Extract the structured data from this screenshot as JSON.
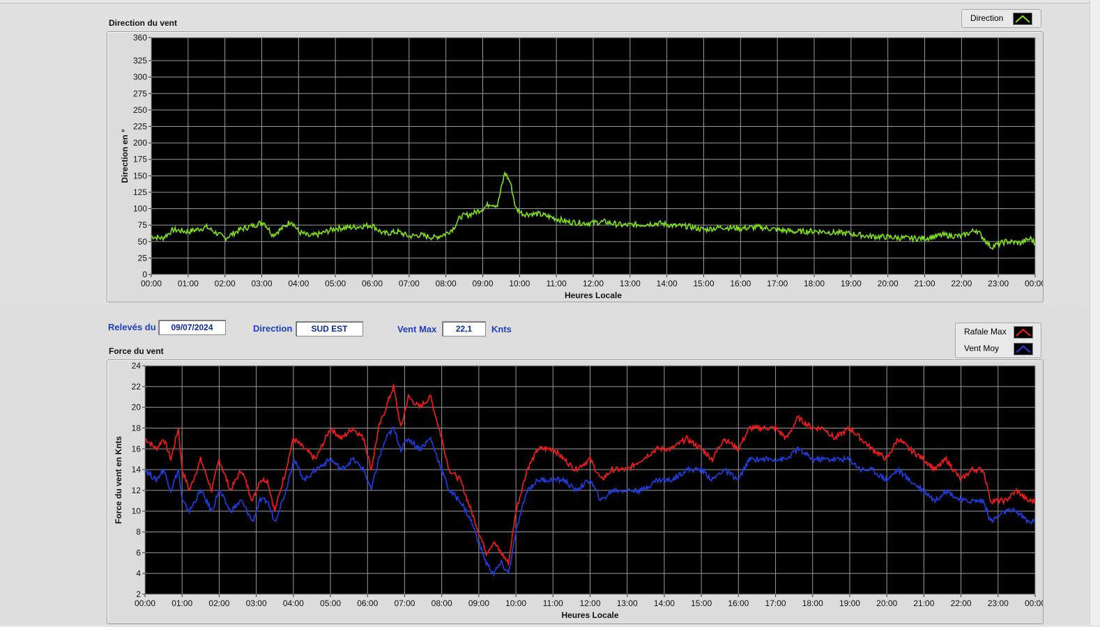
{
  "controls": {
    "releves_label": "Relevés du",
    "releves_value": "09/07/2024",
    "direction_label": "Direction",
    "direction_value": "SUD EST",
    "ventmax_label": "Vent Max",
    "ventmax_value": "22,1",
    "ventmax_unit": "Knts"
  },
  "legends": {
    "direction": "Direction",
    "rafale": "Rafale Max",
    "ventmoy": "Vent Moy"
  },
  "colors": {
    "plot_bg": "#000000",
    "grid": "#9a9a9a",
    "direction": "#7fe31a",
    "rafale": "#ff1a1a",
    "ventmoy": "#1f3fe8",
    "label_blue": "#1f3fbf"
  },
  "chart_data": [
    {
      "type": "line",
      "title": "Direction du vent",
      "xlabel": "Heures Locale",
      "ylabel": "Direction en °",
      "ylim": [
        0,
        360
      ],
      "yticks": [
        0,
        25,
        50,
        75,
        100,
        125,
        150,
        175,
        200,
        225,
        250,
        275,
        300,
        325,
        360
      ],
      "xticks": [
        "00:00",
        "01:00",
        "02:00",
        "03:00",
        "04:00",
        "05:00",
        "06:00",
        "07:00",
        "08:00",
        "09:00",
        "10:00",
        "11:00",
        "12:00",
        "13:00",
        "14:00",
        "15:00",
        "16:00",
        "17:00",
        "18:00",
        "19:00",
        "20:00",
        "21:00",
        "22:00",
        "23:00",
        "00:00"
      ],
      "xlim": [
        0,
        24
      ],
      "grid": true,
      "legend": "top-right",
      "series": [
        {
          "name": "Direction",
          "x": [
            0,
            0.3,
            0.6,
            1,
            1.5,
            1.8,
            2,
            2.4,
            2.8,
            3.05,
            3.3,
            3.6,
            3.8,
            4,
            4.3,
            4.6,
            5,
            5.5,
            6,
            6.3,
            6.7,
            7,
            7.3,
            7.7,
            8,
            8.2,
            8.4,
            8.7,
            9,
            9.2,
            9.4,
            9.6,
            9.75,
            9.9,
            10.1,
            10.5,
            10.8,
            11.3,
            11.8,
            12.3,
            12.8,
            13.3,
            13.8,
            14.2,
            14.6,
            15,
            15.5,
            16,
            16.5,
            17,
            17.5,
            18,
            18.5,
            19,
            19.5,
            20,
            20.5,
            21,
            21.5,
            22,
            22.4,
            22.6,
            22.8,
            23.2,
            23.6,
            23.9,
            24
          ],
          "y": [
            58,
            55,
            68,
            65,
            72,
            62,
            55,
            68,
            75,
            80,
            60,
            72,
            82,
            65,
            58,
            62,
            70,
            72,
            75,
            62,
            65,
            58,
            60,
            56,
            62,
            70,
            88,
            92,
            100,
            108,
            105,
            155,
            140,
            100,
            92,
            92,
            88,
            80,
            78,
            80,
            75,
            76,
            78,
            74,
            73,
            68,
            72,
            70,
            72,
            68,
            65,
            66,
            64,
            62,
            58,
            57,
            55,
            55,
            60,
            58,
            68,
            55,
            42,
            50,
            48,
            55,
            45
          ]
        }
      ]
    },
    {
      "type": "line",
      "title": "Force du vent",
      "xlabel": "Heures Locale",
      "ylabel": "Force du vent en Knts",
      "ylim": [
        2,
        24
      ],
      "yticks": [
        2,
        4,
        6,
        8,
        10,
        12,
        14,
        16,
        18,
        20,
        22,
        24
      ],
      "xticks": [
        "00:00",
        "01:00",
        "02:00",
        "03:00",
        "04:00",
        "05:00",
        "06:00",
        "07:00",
        "08:00",
        "09:00",
        "10:00",
        "11:00",
        "12:00",
        "13:00",
        "14:00",
        "15:00",
        "16:00",
        "17:00",
        "18:00",
        "19:00",
        "20:00",
        "21:00",
        "22:00",
        "23:00",
        "00:00"
      ],
      "xlim": [
        0,
        24
      ],
      "grid": true,
      "legend": "top-right",
      "series": [
        {
          "name": "Rafale Max",
          "x": [
            0,
            0.3,
            0.5,
            0.7,
            0.9,
            1,
            1.2,
            1.5,
            1.8,
            2,
            2.3,
            2.6,
            2.9,
            3.1,
            3.3,
            3.5,
            3.8,
            4,
            4.3,
            4.6,
            5,
            5.3,
            5.6,
            5.9,
            6.1,
            6.3,
            6.5,
            6.7,
            6.9,
            7.1,
            7.4,
            7.7,
            8,
            8.2,
            8.5,
            8.8,
            9,
            9.2,
            9.4,
            9.6,
            9.8,
            10,
            10.3,
            10.6,
            11,
            11.3,
            11.6,
            12,
            12.3,
            12.6,
            13,
            13.4,
            13.8,
            14.2,
            14.6,
            15,
            15.3,
            15.6,
            16,
            16.3,
            16.6,
            17,
            17.3,
            17.6,
            18,
            18.3,
            18.6,
            19,
            19.3,
            19.6,
            20,
            20.3,
            20.6,
            21,
            21.3,
            21.6,
            22,
            22.3,
            22.6,
            22.8,
            23.2,
            23.5,
            23.8,
            24
          ],
          "y": [
            17,
            16,
            17,
            15,
            18,
            14,
            12,
            15,
            12,
            15,
            12,
            14,
            11,
            13,
            13,
            10,
            14,
            17,
            16,
            15,
            18,
            17,
            18,
            17,
            14,
            18,
            20,
            22,
            18,
            21,
            20,
            21,
            17,
            14,
            13,
            10,
            8,
            6,
            7,
            6,
            5,
            10,
            14,
            16,
            16,
            15,
            14,
            15,
            13,
            14,
            14,
            15,
            16,
            16,
            17,
            16,
            15,
            17,
            16,
            18,
            18,
            18,
            17,
            19,
            18,
            18,
            17,
            18,
            17,
            16,
            15,
            17,
            16,
            15,
            14,
            15,
            13,
            14,
            14,
            11,
            11,
            12,
            11,
            11
          ]
        },
        {
          "name": "Vent Moy",
          "x": [
            0,
            0.3,
            0.5,
            0.7,
            0.9,
            1,
            1.2,
            1.5,
            1.8,
            2,
            2.3,
            2.6,
            2.9,
            3.1,
            3.3,
            3.5,
            3.8,
            4,
            4.3,
            4.6,
            5,
            5.3,
            5.6,
            5.9,
            6.1,
            6.3,
            6.5,
            6.7,
            6.9,
            7.1,
            7.4,
            7.7,
            8,
            8.2,
            8.5,
            8.8,
            9,
            9.2,
            9.4,
            9.6,
            9.8,
            10,
            10.3,
            10.6,
            11,
            11.3,
            11.6,
            12,
            12.3,
            12.6,
            13,
            13.4,
            13.8,
            14.2,
            14.6,
            15,
            15.3,
            15.6,
            16,
            16.3,
            16.6,
            17,
            17.3,
            17.6,
            18,
            18.3,
            18.6,
            19,
            19.3,
            19.6,
            20,
            20.3,
            20.6,
            21,
            21.3,
            21.6,
            22,
            22.3,
            22.6,
            22.8,
            23.2,
            23.5,
            23.8,
            24
          ],
          "y": [
            14,
            13,
            14,
            12,
            14,
            11,
            10,
            12,
            10,
            12,
            10,
            11,
            9,
            11,
            11,
            9,
            12,
            15,
            13,
            14,
            15,
            14,
            15,
            14,
            12,
            15,
            17,
            18,
            16,
            17,
            16,
            17,
            14,
            12,
            11,
            9,
            7,
            5,
            4,
            5,
            4,
            8,
            12,
            13,
            13,
            13,
            12,
            13,
            11,
            12,
            12,
            12,
            13,
            13,
            14,
            14,
            13,
            14,
            13,
            15,
            15,
            15,
            15,
            16,
            15,
            15,
            15,
            15,
            14,
            14,
            13,
            14,
            13,
            12,
            11,
            12,
            11,
            11,
            11,
            9,
            10,
            10,
            9,
            9
          ]
        }
      ]
    }
  ]
}
